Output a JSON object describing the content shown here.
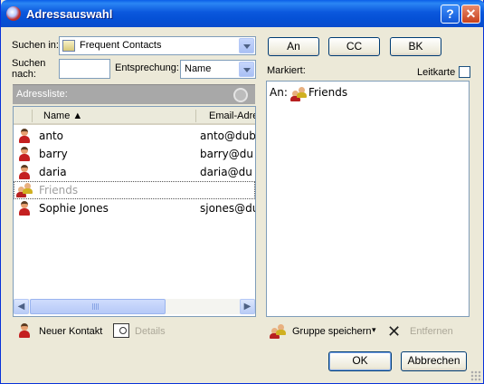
{
  "window": {
    "title": "Adressauswahl",
    "help": "?",
    "close": "✕"
  },
  "search": {
    "in_label": "Suchen in:",
    "in_value": "Frequent Contacts",
    "by_label_line1": "Suchen",
    "by_label_line2": "nach:",
    "by_value": "",
    "match_label": "Entsprechung:",
    "match_value": "Name"
  },
  "address_list": {
    "header": "Adressliste:",
    "columns": {
      "name": "Name ▲",
      "email": "Email-Adre"
    },
    "rows": [
      {
        "name": "anto",
        "email": "anto@dub",
        "kind": "person"
      },
      {
        "name": "barry",
        "email": "barry@du",
        "kind": "person"
      },
      {
        "name": "daria",
        "email": "daria@du",
        "kind": "person"
      },
      {
        "name": "Friends",
        "email": "",
        "kind": "group"
      },
      {
        "name": "Sophie Jones",
        "email": "sjones@du",
        "kind": "person"
      }
    ]
  },
  "recipient_buttons": {
    "to": "An",
    "cc": "CC",
    "bcc": "BK"
  },
  "marked": {
    "label": "Markiert:",
    "guide_label": "Leitkarte",
    "guide_checked": false,
    "entry_prefix": "An:",
    "entry_value": "Friends"
  },
  "bottom_left": {
    "new_contact": "Neuer Kontakt",
    "details": "Details"
  },
  "bottom_right": {
    "save_group": "Gruppe speichern",
    "remove": "Entfernen"
  },
  "dialog_buttons": {
    "ok": "OK",
    "cancel": "Abbrechen"
  },
  "colors": {
    "titlebar": "#0b58dd",
    "dialog_bg": "#ece9d8",
    "list_header_bg": "#a8a8a8",
    "disabled_text": "#aca899"
  }
}
